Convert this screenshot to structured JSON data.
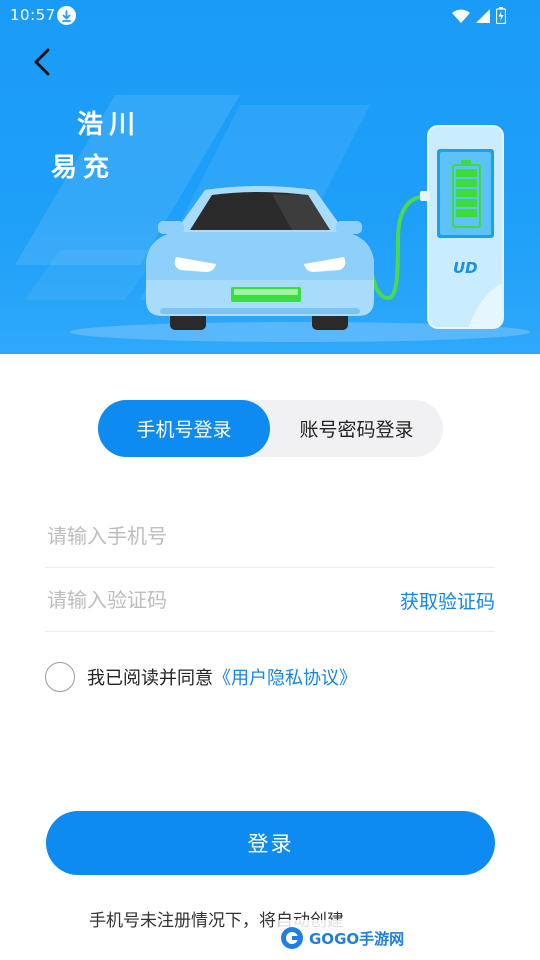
{
  "status_bar": {
    "time": "10:57",
    "icons": [
      "download-icon",
      "wifi-icon",
      "signal-icon",
      "battery-icon"
    ]
  },
  "header": {
    "back_icon": "chevron-left-icon",
    "brand_line1": "浩川",
    "brand_line2": "易充",
    "charger_logo": "UD"
  },
  "tabs": [
    {
      "label": "手机号登录",
      "active": true
    },
    {
      "label": "账号密码登录",
      "active": false
    }
  ],
  "form": {
    "phone_placeholder": "请输入手机号",
    "phone_value": "",
    "code_placeholder": "请输入验证码",
    "code_value": "",
    "get_code_label": "获取验证码"
  },
  "agreement": {
    "checked": false,
    "text": "我已阅读并同意",
    "link": "《用户隐私协议》"
  },
  "login_button": "登录",
  "footer_note": "手机号未注册情况下，将自动创建",
  "watermark": {
    "text": "GOGO手游网"
  },
  "colors": {
    "primary": "#0d8bf1",
    "link": "#1686e6",
    "hero_bg": "#1e9ff8",
    "battery_green": "#3ddc3d"
  }
}
